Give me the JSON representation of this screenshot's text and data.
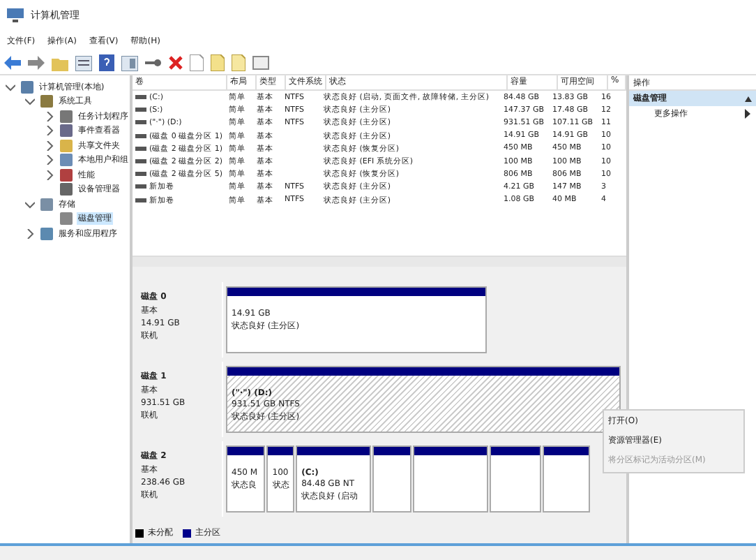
{
  "window": {
    "title": "计算机管理"
  },
  "menu": [
    "文件(F)",
    "操作(A)",
    "查看(V)",
    "帮助(H)"
  ],
  "tree": [
    {
      "label": "计算机管理(本地)",
      "expanded": true,
      "selected": false,
      "children": [
        {
          "label": "系统工具",
          "expanded": true,
          "selected": false,
          "children": [
            {
              "label": "任务计划程序",
              "expanded": false,
              "selected": false
            },
            {
              "label": "事件查看器",
              "expanded": false,
              "selected": false
            },
            {
              "label": "共享文件夹",
              "expanded": false,
              "selected": false
            },
            {
              "label": "本地用户和组",
              "expanded": false,
              "selected": false
            },
            {
              "label": "性能",
              "expanded": false,
              "selected": false
            },
            {
              "label": "设备管理器",
              "selected": false
            }
          ]
        },
        {
          "label": "存储",
          "expanded": true,
          "selected": false,
          "children": [
            {
              "label": "磁盘管理",
              "selected": true
            }
          ]
        },
        {
          "label": "服务和应用程序",
          "expanded": false,
          "selected": false
        }
      ]
    }
  ],
  "volumes": {
    "columns": [
      "卷",
      "布局",
      "类型",
      "文件系统",
      "状态",
      "容量",
      "可用空间",
      "%"
    ],
    "rows": [
      [
        "(C:)",
        "简单",
        "基本",
        "NTFS",
        "状态良好 (启动, 页面文件, 故障转储, 主分区)",
        "84.48 GB",
        "13.83 GB",
        "16"
      ],
      [
        "(S:)",
        "简单",
        "基本",
        "NTFS",
        "状态良好 (主分区)",
        "147.37 GB",
        "17.48 GB",
        "12"
      ],
      [
        "(\"·\") (D:)",
        "简单",
        "基本",
        "NTFS",
        "状态良好 (主分区)",
        "931.51 GB",
        "107.11 GB",
        "11"
      ],
      [
        "(磁盘 0 磁盘分区 1)",
        "简单",
        "基本",
        "",
        "状态良好 (主分区)",
        "14.91 GB",
        "14.91 GB",
        "10"
      ],
      [
        "(磁盘 2 磁盘分区 1)",
        "简单",
        "基本",
        "",
        "状态良好 (恢复分区)",
        "450 MB",
        "450 MB",
        "10"
      ],
      [
        "(磁盘 2 磁盘分区 2)",
        "简单",
        "基本",
        "",
        "状态良好 (EFI 系统分区)",
        "100 MB",
        "100 MB",
        "10"
      ],
      [
        "(磁盘 2 磁盘分区 5)",
        "简单",
        "基本",
        "",
        "状态良好 (恢复分区)",
        "806 MB",
        "806 MB",
        "10"
      ],
      [
        "新加卷",
        "简单",
        "基本",
        "NTFS",
        "状态良好 (主分区)",
        "4.21 GB",
        "147 MB",
        "3"
      ],
      [
        "新加卷",
        "简单",
        "基本",
        "NTFS",
        "状态良好 (主分区)",
        "1.08 GB",
        "40 MB",
        "4"
      ]
    ]
  },
  "disks": [
    {
      "name": "磁盘 0",
      "type": "基本",
      "size": "14.91 GB",
      "status": "联机",
      "partitions": [
        {
          "selected": false,
          "size": "14.91 GB",
          "status": "状态良好 (主分区)"
        }
      ]
    },
    {
      "name": "磁盘 1",
      "type": "基本",
      "size": "931.51 GB",
      "status": "联机",
      "partitions": [
        {
          "selected": true,
          "label": "(\"·\")  (D:)",
          "size": "931.51 GB NTFS",
          "status": "状态良好 (主分区)"
        }
      ]
    },
    {
      "name": "磁盘 2",
      "type": "基本",
      "size": "238.46 GB",
      "status": "联机",
      "partitions": [
        {
          "selected": false,
          "size": "450 M",
          "status": "状态良"
        },
        {
          "selected": false,
          "size": "100",
          "status": "状态"
        },
        {
          "selected": false,
          "label": "(C:)",
          "size": "84.48 GB NT",
          "status": "状态良好 (启动"
        },
        {
          "selected": false
        },
        {
          "selected": false
        },
        {
          "selected": false
        },
        {
          "selected": false
        }
      ]
    }
  ],
  "legend": [
    {
      "label": "未分配",
      "color": "#000000"
    },
    {
      "label": "主分区",
      "color": "#00008b"
    }
  ],
  "actions": {
    "header": "操作",
    "section": "磁盘管理",
    "expanded": true,
    "items": [
      "更多操作"
    ]
  },
  "context_menu": [
    {
      "label": "打开(O)",
      "disabled": false
    },
    {
      "label": "资源管理器(E)",
      "disabled": false
    },
    {
      "label": "将分区标记为活动分区(M)",
      "disabled": true
    }
  ]
}
